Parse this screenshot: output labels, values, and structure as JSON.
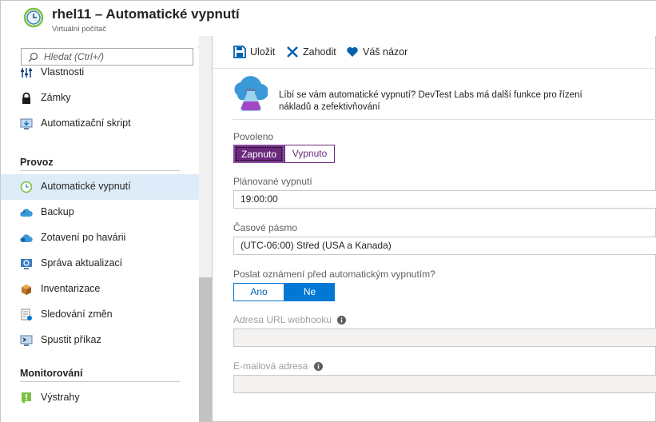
{
  "header": {
    "title": "rhel11 – Automatické vypnutí",
    "subtitle": "Virtuální počítač"
  },
  "sidebar": {
    "collapse": "«",
    "search_placeholder": "Hledat (Ctrl+/)",
    "items": [
      {
        "label": "Vlastnosti",
        "icon": "properties-icon"
      },
      {
        "label": "Zámky",
        "icon": "lock-icon"
      },
      {
        "label": "Automatizační skript",
        "icon": "automation-script-icon"
      }
    ],
    "sections": [
      {
        "title": "Provoz",
        "items": [
          {
            "label": "Automatické vypnutí",
            "icon": "clock-icon",
            "active": true
          },
          {
            "label": "Backup",
            "icon": "backup-cloud-icon"
          },
          {
            "label": "Zotavení po havárii",
            "icon": "disaster-recovery-icon"
          },
          {
            "label": "Správa aktualizací",
            "icon": "update-management-icon"
          },
          {
            "label": "Inventarizace",
            "icon": "inventory-icon"
          },
          {
            "label": "Sledování změn",
            "icon": "change-tracking-icon"
          },
          {
            "label": "Spustit příkaz",
            "icon": "run-command-icon"
          }
        ]
      },
      {
        "title": "Monitorování",
        "items": [
          {
            "label": "Výstrahy",
            "icon": "alerts-icon"
          }
        ]
      }
    ]
  },
  "toolbar": {
    "save_label": "Uložit",
    "discard_label": "Zahodit",
    "feedback_label": "Váš názor"
  },
  "promo": {
    "text": "Líbí se vám automatické vypnutí? DevTest Labs má další funkce pro řízení nákladů a zefektivňování"
  },
  "form": {
    "enabled": {
      "label": "Povoleno",
      "on": "Zapnuto",
      "off": "Vypnuto",
      "selected": "Zapnuto"
    },
    "scheduled_time": {
      "label": "Plánované vypnutí",
      "value": "19:00:00"
    },
    "timezone": {
      "label": "Časové pásmo",
      "value": "(UTC-06:00) Střed (USA a Kanada)"
    },
    "notify": {
      "label": "Poslat oznámení před automatickým vypnutím?",
      "yes": "Ano",
      "no": "Ne",
      "selected": "Ne"
    },
    "webhook": {
      "label": "Adresa URL webhooku",
      "value": ""
    },
    "email": {
      "label": "E-mailová adresa",
      "value": ""
    }
  },
  "colors": {
    "accent_blue": "#0078d4",
    "toggle_purple": "#6b2a7e",
    "active_nav": "#deecf9"
  }
}
